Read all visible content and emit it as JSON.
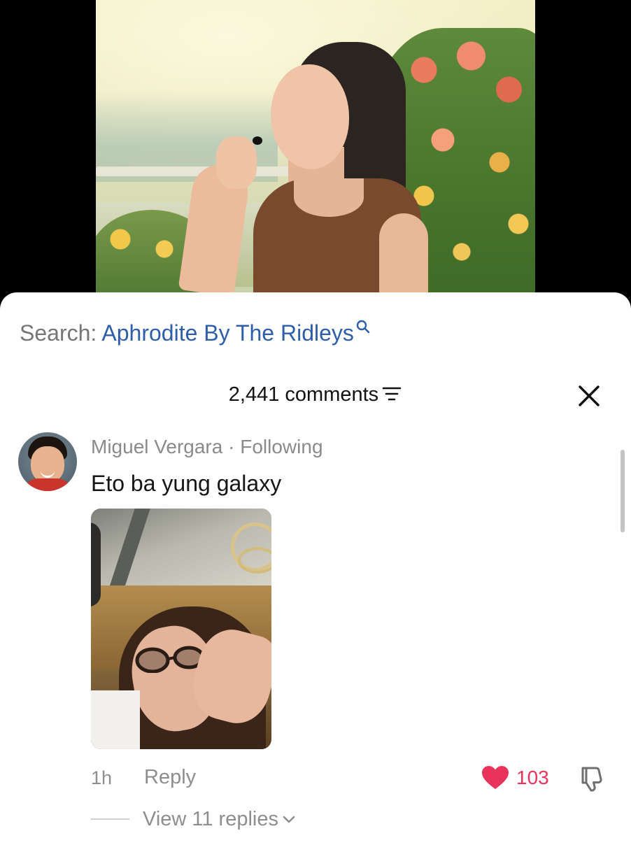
{
  "search": {
    "label": "Search:",
    "term": "Aphrodite By The Ridleys"
  },
  "comments": {
    "count_label": "2,441 comments"
  },
  "comment": {
    "author": "Miguel Vergara",
    "separator": " · ",
    "relation": "Following",
    "text": "Eto ba yung galaxy",
    "time": "1h",
    "reply_label": "Reply",
    "likes": "103",
    "view_replies_label": "View 11 replies"
  },
  "colors": {
    "link_blue": "#2f5ea9",
    "like_red": "#e8345a",
    "muted_gray": "#8e8e8e"
  },
  "icons": {
    "search": "search-icon",
    "sort": "filter-sort-icon",
    "close": "close-icon",
    "like": "heart-icon",
    "dislike": "thumbs-down-icon",
    "expand": "chevron-down-icon"
  }
}
